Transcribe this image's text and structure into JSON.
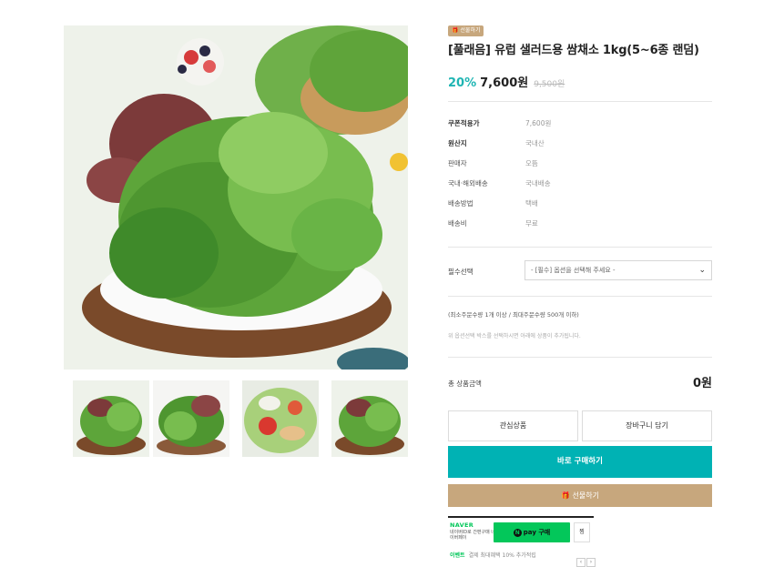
{
  "product": {
    "badge": "🎁 선물하기",
    "title": "[풀래음] 유럽 샐러드용 쌈채소 1kg(5~6종 랜덤)",
    "discount": "20%",
    "price": "7,600원",
    "original_price": "9,500원"
  },
  "specs": [
    {
      "key": "쿠폰적용가",
      "value": "7,600원"
    },
    {
      "key": "원산지",
      "value": "국내산"
    },
    {
      "key": "판매자",
      "value": "오뜸"
    },
    {
      "key": "국내·해외배송",
      "value": "국내배송"
    },
    {
      "key": "배송방법",
      "value": "택배"
    },
    {
      "key": "배송비",
      "value": "무료"
    }
  ],
  "option": {
    "label": "필수선택",
    "placeholder": "- [필수] 옵션을 선택해 주세요 -"
  },
  "notes": {
    "quantity": "(최소주문수량 1개 이상 / 최대주문수량 500개 이하)",
    "hint": "위 옵션선택 박스를 선택하시면 아래에 상품이 추가됩니다."
  },
  "total": {
    "label": "총 상품금액",
    "value": "0원"
  },
  "buttons": {
    "wishlist": "관심상품",
    "cart": "장바구니 담기",
    "buy_now": "바로 구매하기",
    "gift": "🎁 선물하기"
  },
  "naver": {
    "logo": "NAVER",
    "desc": "네이버ID로 간편구매 네이버페이",
    "pay_label": "pay 구매",
    "wish_label": "찜",
    "event_tag": "이벤트",
    "event_text": "결제 최대혜택 10% 추가적립"
  },
  "colors": {
    "accent": "#00b2b4",
    "gift": "#c7a77d",
    "naver": "#03c75a"
  }
}
